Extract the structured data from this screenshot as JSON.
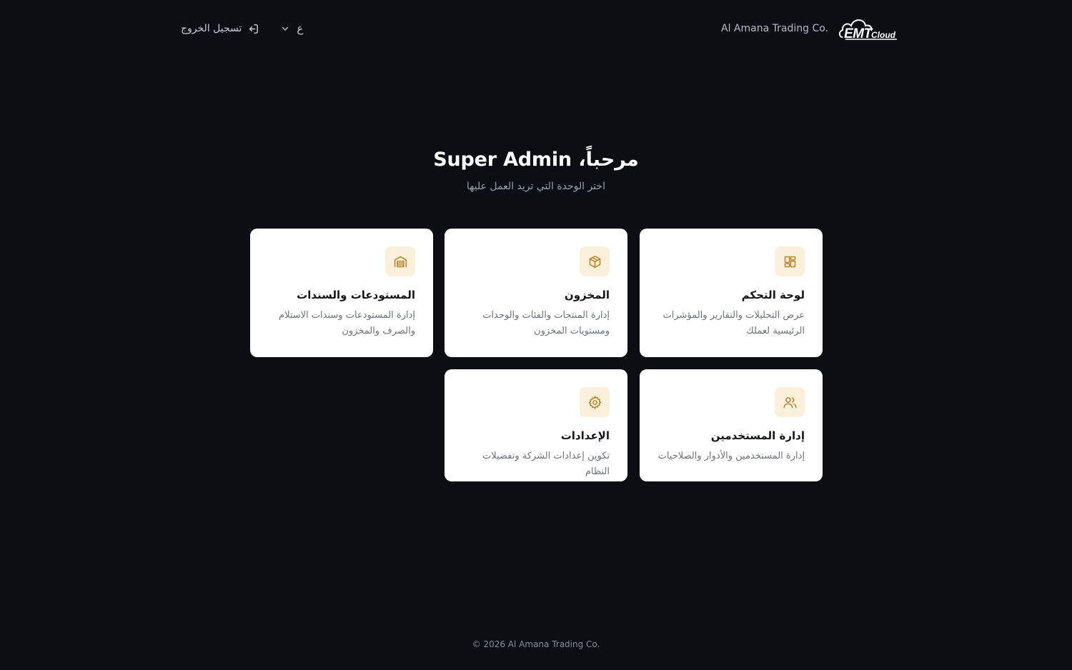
{
  "header": {
    "logo_text": "EMTCloud",
    "company_name": "Al Amana Trading Co.",
    "language_selected": "ع",
    "logout_label": "تسجيل الخروج"
  },
  "hero": {
    "welcome": "مرحباً، Super Admin",
    "subtitle": "اختر الوحدة التي تريد العمل عليها"
  },
  "modules": [
    {
      "title": "لوحة التحكم",
      "description": "عرض التحليلات والتقارير والمؤشرات الرئيسية لعملك",
      "icon": "dashboard-grid-icon"
    },
    {
      "title": "المخزون",
      "description": "إدارة المنتجات والفئات والوحدات ومستويات المخزون",
      "icon": "package-icon"
    },
    {
      "title": "المستودعات والسندات",
      "description": "إدارة المستودعات وسندات الاستلام والصرف والمخزون",
      "icon": "warehouse-icon"
    },
    {
      "title": "إدارة المستخدمين",
      "description": "إدارة المستخدمين والأدوار والصلاحيات",
      "icon": "users-icon"
    },
    {
      "title": "الإعدادات",
      "description": "تكوين إعدادات الشركة وتفضيلات النظام",
      "icon": "gear-icon"
    }
  ],
  "footer": {
    "copyright": "© 2026 Al Amana Trading Co."
  },
  "colors": {
    "background": "#0b0e12",
    "card": "#ffffff",
    "accent": "#b8862b",
    "icon_bg": "#fbf0dc"
  }
}
